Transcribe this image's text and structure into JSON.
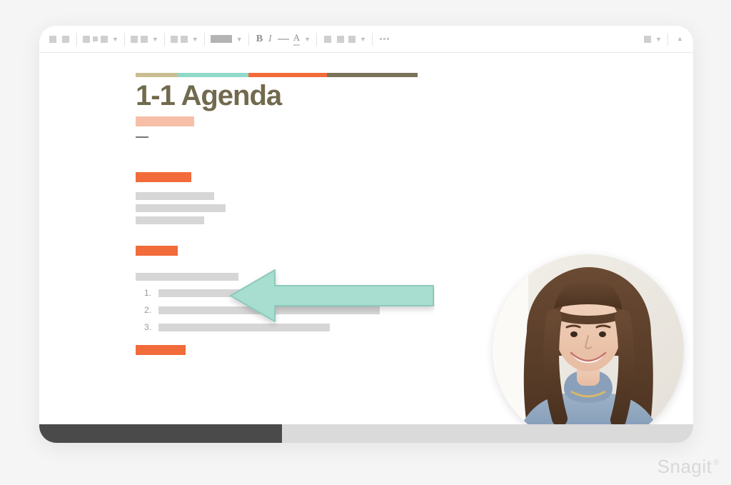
{
  "toolbar": {
    "bold_label": "B",
    "italic_label": "I",
    "text_color_label": "A"
  },
  "document": {
    "title": "1-1 Agenda",
    "list_numbers": [
      "1.",
      "2.",
      "3."
    ]
  },
  "annotation": {
    "arrow_color": "#a7ded0",
    "arrow_stroke": "#8dc9bb"
  },
  "watermark": "Snagit"
}
